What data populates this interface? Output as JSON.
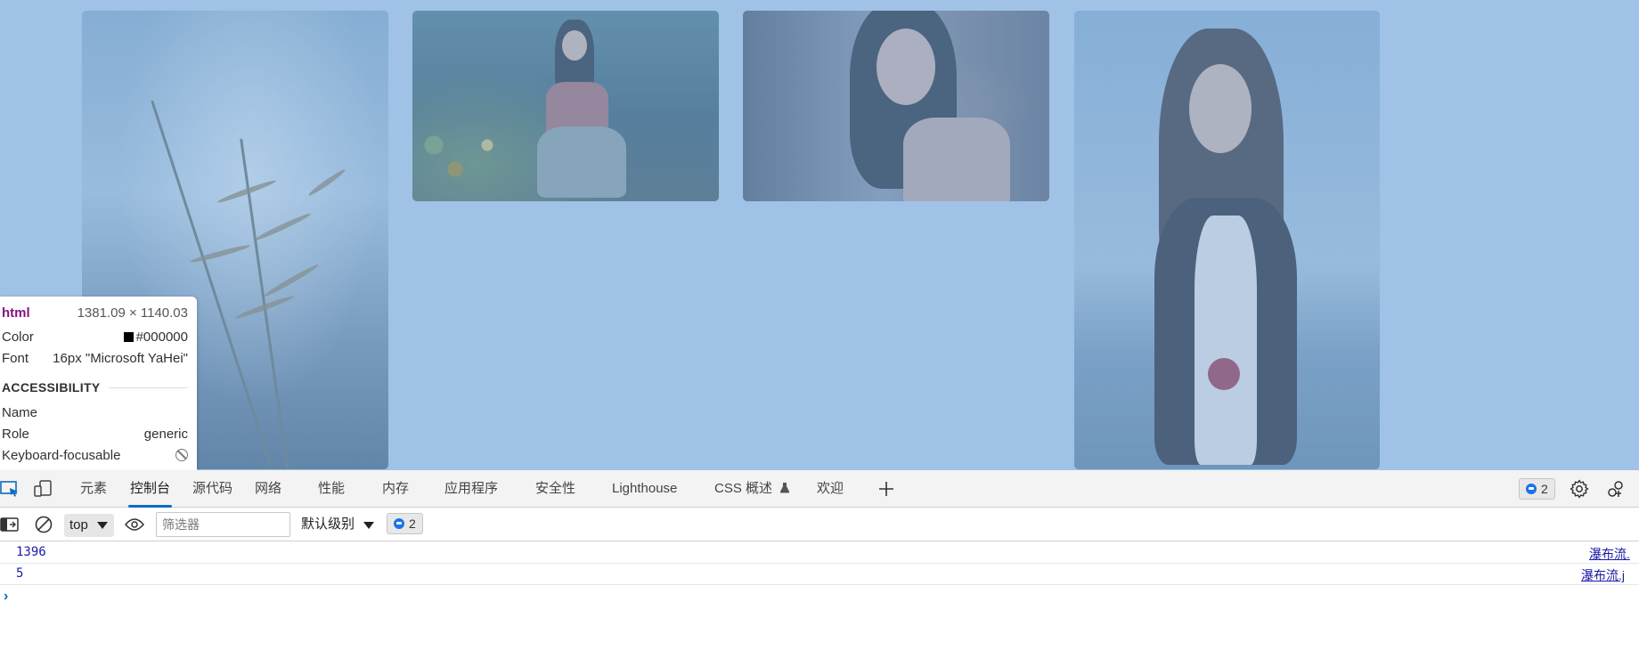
{
  "inspector": {
    "tag": "html",
    "dimensions": "1381.09 × 1140.03",
    "color_label": "Color",
    "color_value": "#000000",
    "font_label": "Font",
    "font_value": "16px \"Microsoft YaHei\"",
    "section": "ACCESSIBILITY",
    "name_label": "Name",
    "role_label": "Role",
    "role_value": "generic",
    "keyboard_label": "Keyboard-focusable"
  },
  "devtools": {
    "tabs": [
      {
        "label": "元素"
      },
      {
        "label": "控制台",
        "active": true
      },
      {
        "label": "源代码"
      },
      {
        "label": "网络"
      },
      {
        "label": "性能"
      },
      {
        "label": "内存"
      },
      {
        "label": "应用程序"
      },
      {
        "label": "安全性"
      },
      {
        "label": "Lighthouse"
      },
      {
        "label": "CSS 概述"
      },
      {
        "label": "欢迎"
      }
    ],
    "issues_count": "2",
    "toolbar": {
      "context": "top",
      "filter_placeholder": "筛选器",
      "level": "默认级别",
      "messages_count": "2"
    },
    "console": {
      "rows": [
        {
          "value": "1396",
          "source": "瀑布流."
        },
        {
          "value": "5",
          "source": "瀑布流.j"
        }
      ],
      "prompt": "›"
    }
  },
  "colors": {
    "viewport_highlight": "#a0c2e6",
    "accent": "#0f6cbd",
    "tag_color": "#881280"
  }
}
